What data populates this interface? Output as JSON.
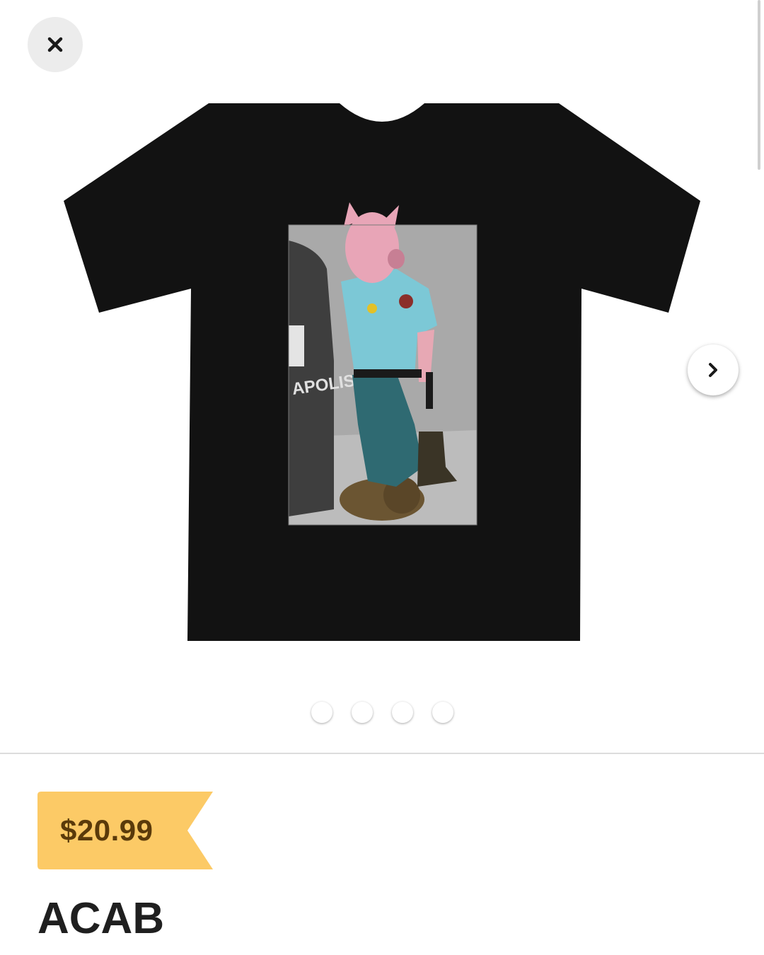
{
  "product": {
    "title": "ACAB",
    "price": "$20.99",
    "image_description": "black t-shirt with illustration",
    "illustration_text": "APOLIS"
  },
  "gallery": {
    "image_count": 4,
    "current_index": 0
  },
  "icons": {
    "close": "close-icon",
    "next": "chevron-right-icon"
  },
  "colors": {
    "price_tag": "#fcca66",
    "price_text": "#5a3a0a",
    "shirt": "#121212"
  }
}
